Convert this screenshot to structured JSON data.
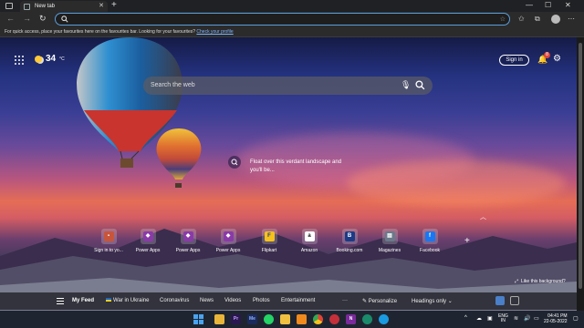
{
  "tab": {
    "title": "New tab"
  },
  "favbar": {
    "message": "For quick access, place your favourites here on the favourites bar. Looking for your favourites?",
    "link": "Check your profile"
  },
  "weather": {
    "temperature": "34",
    "unit": "°C"
  },
  "header": {
    "signin_label": "Sign in",
    "notification_count": "8"
  },
  "search": {
    "placeholder": "Search the web"
  },
  "caption": {
    "text": "Float over this verdant landscape and you'll be..."
  },
  "quick_links": [
    {
      "label": "Sign in to yo...",
      "icon": "office-icon",
      "color": "#c8553b"
    },
    {
      "label": "Power Apps",
      "icon": "power-apps-icon",
      "color": "#8a3aa8"
    },
    {
      "label": "Power Apps",
      "icon": "power-apps-icon",
      "color": "#8a3aa8"
    },
    {
      "label": "Power Apps",
      "icon": "power-apps-icon",
      "color": "#8a3aa8"
    },
    {
      "label": "Flipkart",
      "icon": "flipkart-icon",
      "color": "#f6c21c"
    },
    {
      "label": "Amazon",
      "icon": "amazon-icon",
      "color": "#111111"
    },
    {
      "label": "Booking.com",
      "icon": "booking-icon",
      "color": "#1b3b86"
    },
    {
      "label": "Magazines",
      "icon": "magazines-icon",
      "color": "#6a7a8a"
    },
    {
      "label": "Facebook",
      "icon": "facebook-icon",
      "color": "#1877f2"
    }
  ],
  "like_background": "Like this background?",
  "feed": {
    "items": [
      "My Feed",
      "War in Ukraine",
      "Coronavirus",
      "News",
      "Videos",
      "Photos",
      "Entertainment"
    ],
    "more": "···",
    "personalize": "Personalize",
    "headings": "Headings only"
  },
  "taskbar": {
    "apps": [
      {
        "name": "file-explorer-icon",
        "label": "",
        "color": "#e8b53a"
      },
      {
        "name": "premiere-icon",
        "label": "Pr",
        "color": "#2a1850"
      },
      {
        "name": "media-encoder-icon",
        "label": "Me",
        "color": "#1a2a5a"
      },
      {
        "name": "whatsapp-icon",
        "label": "",
        "color": "#25d366"
      },
      {
        "name": "folder-icon",
        "label": "",
        "color": "#f0c040"
      },
      {
        "name": "vlc-icon",
        "label": "",
        "color": "#f08a1c"
      },
      {
        "name": "chrome-icon",
        "label": "",
        "color": "#e04438"
      },
      {
        "name": "red-app-icon",
        "label": "",
        "color": "#c4303a"
      },
      {
        "name": "onenote-icon",
        "label": "N",
        "color": "#7a2a9a"
      },
      {
        "name": "edge-dev-icon",
        "label": "",
        "color": "#1a8a6a"
      },
      {
        "name": "edge-icon",
        "label": "",
        "color": "#1a9ae0"
      }
    ],
    "lang": "ENG",
    "region": "IN",
    "time": "04:41 PM",
    "date": "22-05-2022"
  },
  "colors": {
    "accent": "#5b9fdc",
    "badge": "#e0463c"
  }
}
